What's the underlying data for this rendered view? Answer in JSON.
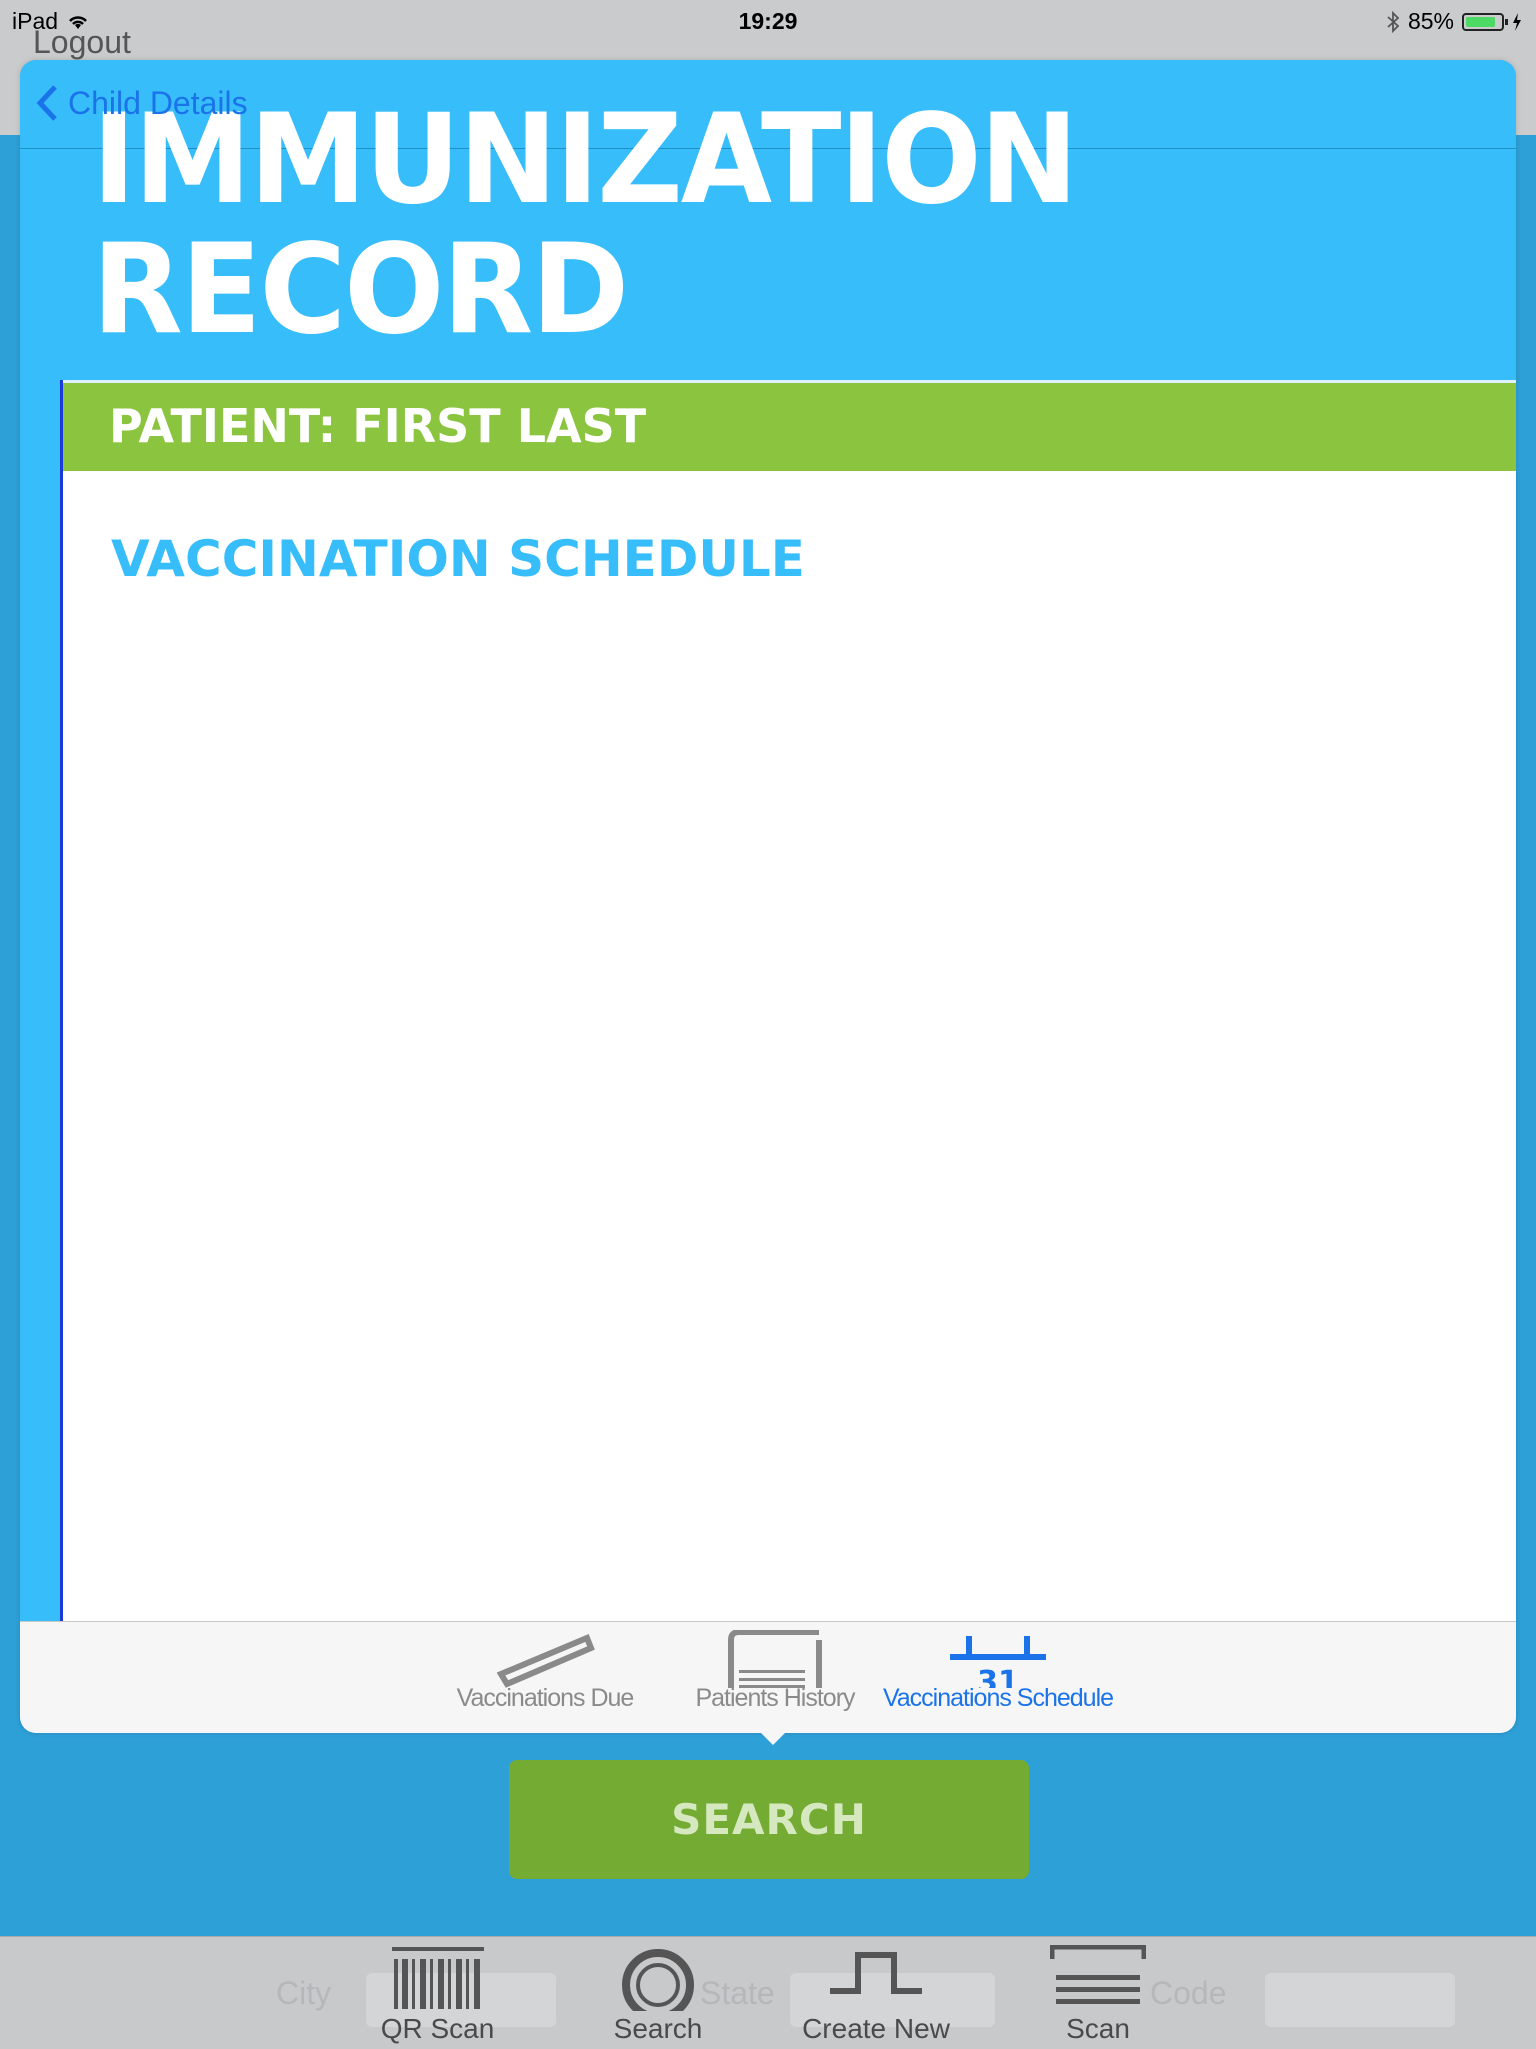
{
  "status_bar": {
    "device": "iPad",
    "time": "19:29",
    "battery_percent_label": "85%",
    "battery_level": 0.85
  },
  "background": {
    "logout_label": "Logout",
    "search_button": "SEARCH",
    "ghost_labels": [
      "City",
      "State",
      "Code"
    ],
    "tabbar": [
      {
        "label": "QR Scan",
        "icon": "barcode-icon"
      },
      {
        "label": "Search",
        "icon": "search-icon"
      },
      {
        "label": "Create New",
        "icon": "create-icon"
      },
      {
        "label": "Scan",
        "icon": "scan-icon"
      }
    ]
  },
  "modal": {
    "back_label": "Child Details",
    "title_line1": "IMMUNIZATION",
    "title_line2": "RECORD",
    "patient_label": "PATIENT: FIRST LAST",
    "section_heading": "VACCINATION SCHEDULE",
    "tabs": [
      {
        "label": "Vaccinations Due",
        "icon": "syringe-icon",
        "active": false
      },
      {
        "label": "Patients History",
        "icon": "history-icon",
        "active": false
      },
      {
        "label": "Vaccinations Schedule",
        "icon": "calendar-icon",
        "active": true
      }
    ]
  },
  "colors": {
    "modal_blue": "#38bdfb",
    "background_blue": "#2ea0d8",
    "patient_green": "#8bc540",
    "search_green": "#74ab32",
    "active_tab": "#1a73e8"
  }
}
